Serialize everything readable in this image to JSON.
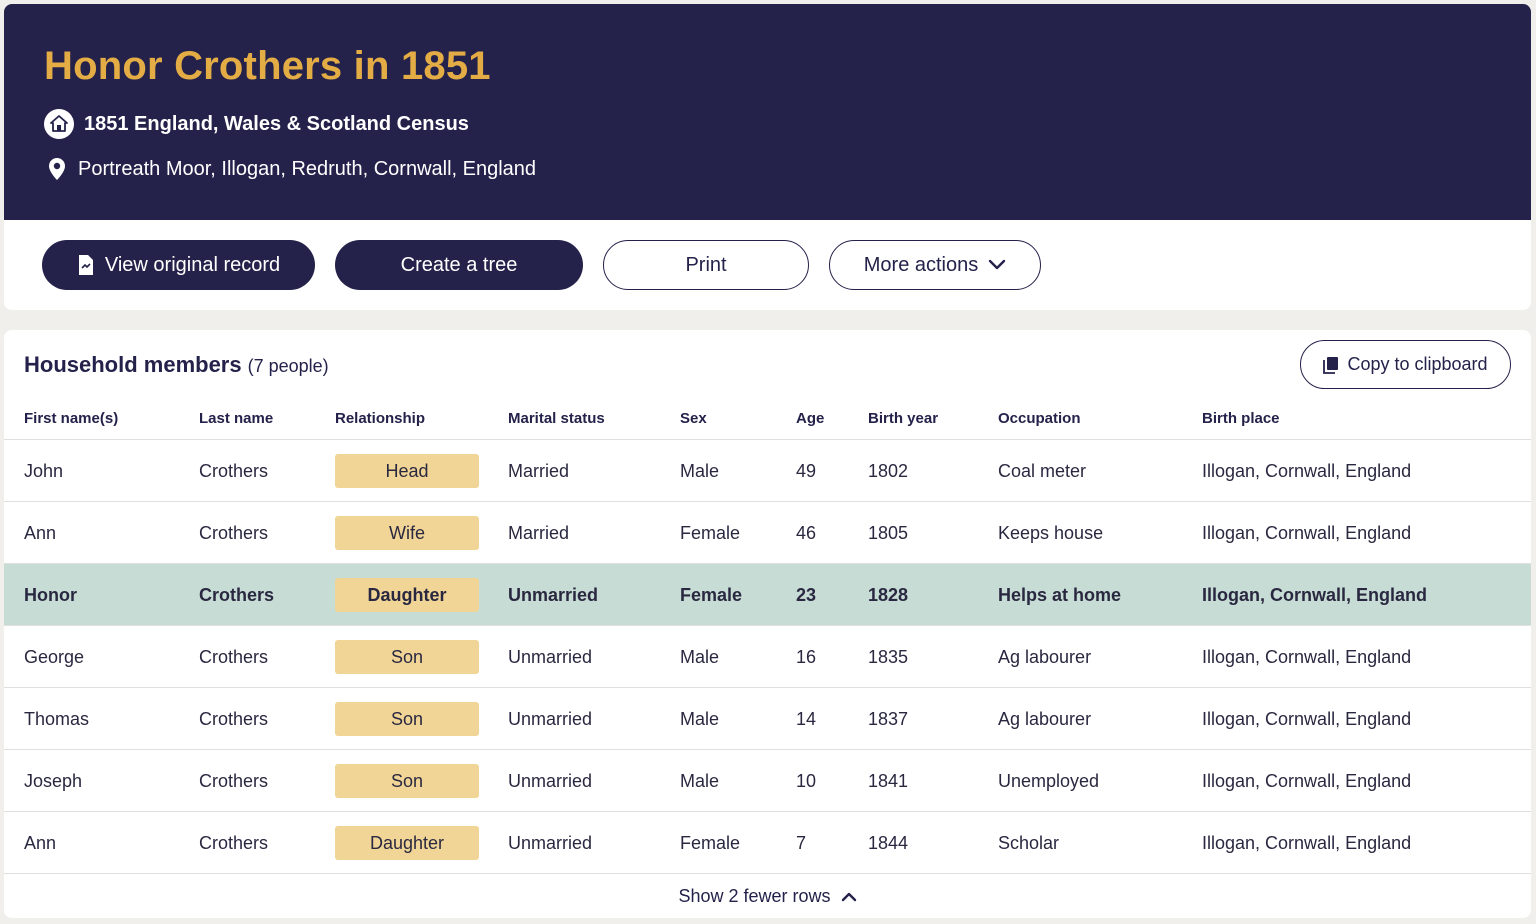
{
  "header": {
    "title": "Honor Crothers in 1851",
    "census": "1851 England, Wales & Scotland Census",
    "location": "Portreath Moor, Illogan, Redruth, Cornwall, England",
    "census_icon": "house-icon",
    "location_icon": "map-pin-icon"
  },
  "actions": {
    "view_original": "View original record",
    "create_tree": "Create a tree",
    "print": "Print",
    "more_actions": "More actions"
  },
  "household": {
    "title": "Household members",
    "count": "(7 people)",
    "copy_label": "Copy to clipboard",
    "columns": [
      "First name(s)",
      "Last name",
      "Relationship",
      "Marital status",
      "Sex",
      "Age",
      "Birth year",
      "Occupation",
      "Birth place"
    ],
    "rows": [
      [
        "John",
        "Crothers",
        "Head",
        "Married",
        "Male",
        "49",
        "1802",
        "Coal meter",
        "Illogan, Cornwall, England"
      ],
      [
        "Ann",
        "Crothers",
        "Wife",
        "Married",
        "Female",
        "46",
        "1805",
        "Keeps house",
        "Illogan, Cornwall, England"
      ],
      [
        "Honor",
        "Crothers",
        "Daughter",
        "Unmarried",
        "Female",
        "23",
        "1828",
        "Helps at home",
        "Illogan, Cornwall, England"
      ],
      [
        "George",
        "Crothers",
        "Son",
        "Unmarried",
        "Male",
        "16",
        "1835",
        "Ag labourer",
        "Illogan, Cornwall, England"
      ],
      [
        "Thomas",
        "Crothers",
        "Son",
        "Unmarried",
        "Male",
        "14",
        "1837",
        "Ag labourer",
        "Illogan, Cornwall, England"
      ],
      [
        "Joseph",
        "Crothers",
        "Son",
        "Unmarried",
        "Male",
        "10",
        "1841",
        "Unemployed",
        "Illogan, Cornwall, England"
      ],
      [
        "Ann",
        "Crothers",
        "Daughter",
        "Unmarried",
        "Female",
        "7",
        "1844",
        "Scholar",
        "Illogan, Cornwall, England"
      ]
    ],
    "highlighted_row": 2,
    "footer": "Show 2 fewer rows"
  },
  "colors": {
    "header_bg": "#24224a",
    "title": "#e3ac45",
    "badge": "#f0d596",
    "highlight": "#c6dcd4"
  }
}
